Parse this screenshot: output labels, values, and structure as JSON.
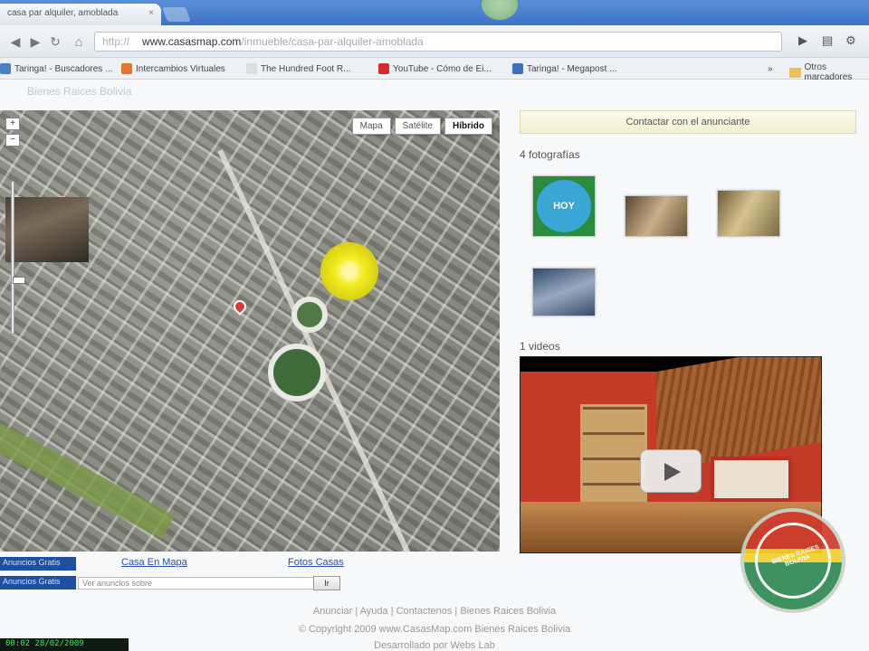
{
  "browser": {
    "tab_title": "casa par alquiler, amoblada",
    "tab_close": "×",
    "url_scheme": "http://",
    "url_host": "www.casasmap.com",
    "url_path": "/inmueble/casa-par-alquiler-amoblada",
    "nav": {
      "back": "◀",
      "forward": "▶",
      "reload": "↻",
      "home": "⌂"
    },
    "toolbar_right": {
      "go": "▶",
      "page_menu": "▤",
      "tools_menu": "⚙"
    }
  },
  "bookmarks": {
    "items": [
      {
        "label": "Taringa! - Buscadores ...",
        "icon_color": "#4a7fc9"
      },
      {
        "label": "Intercambios Virtuales",
        "icon_color": "#e8762a"
      },
      {
        "label": "The Hundred Foot R...",
        "icon_color": "#dddddd"
      },
      {
        "label": "YouTube - Cómo de Ei...",
        "icon_color": "#d62a2a"
      },
      {
        "label": "Taringa! - Megapost ...",
        "icon_color": "#3d6fc0"
      }
    ],
    "more": "»",
    "other_folder": "Otros marcadores"
  },
  "page": {
    "site_crumb": "Bienes Raices Bolivia",
    "map_types": [
      "Mapa",
      "Satélite",
      "Híbrido"
    ],
    "map_type_selected": "Híbrido",
    "zoom": {
      "in": "+",
      "out": "−"
    },
    "contact_button": "Contactar con el anunciante",
    "photos_title": "4 fotografías",
    "photo_badge": "HOY",
    "videos_title": "1 videos",
    "bottom": {
      "tag1": "Anuncios Gratis",
      "tag2": "Anuncios Gratis",
      "link_map": "Casa En Mapa",
      "link_photos": "Fotos Casas",
      "search_placeholder": "Ver anuncios sobre",
      "search_button": "Ir"
    },
    "footer": {
      "links": "Anunciar | Ayuda | Contactenos | Bienes Raices Bolivia",
      "copyright": "© Copyright 2009 www.CasasMap.com Bienes Raices Bolivia",
      "developed": "Desarrollado por Webs Lab"
    },
    "clock": "00:02 28/02/2009",
    "seal_text": "BIENES RAICES BOLIVIA"
  },
  "colors": {
    "accent_blue": "#1d4fa2",
    "link_blue": "#2a4fb5",
    "pin_red": "#d93a3a",
    "pegman_yellow": "#f2ec1e"
  }
}
